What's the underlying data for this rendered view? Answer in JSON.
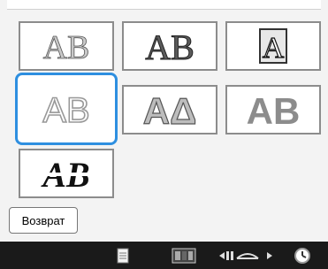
{
  "tiles": [
    {
      "id": "1",
      "text": "AB"
    },
    {
      "id": "2",
      "text": "AB"
    },
    {
      "id": "3",
      "text": "A"
    },
    {
      "id": "4",
      "text": "AB"
    },
    {
      "id": "5",
      "text": "AΔ"
    },
    {
      "id": "6",
      "text": "AB"
    },
    {
      "id": "7",
      "text": "AB"
    }
  ],
  "selected_tile": "4",
  "back_button": {
    "label": "Возврат"
  },
  "bottom_bar": {
    "icons": [
      "document-icon",
      "pattern-icon",
      "width-adjust-icon",
      "clock-icon"
    ]
  },
  "colors": {
    "selection": "#2e8fe0",
    "bottom_bar": "#1a1a1a"
  }
}
